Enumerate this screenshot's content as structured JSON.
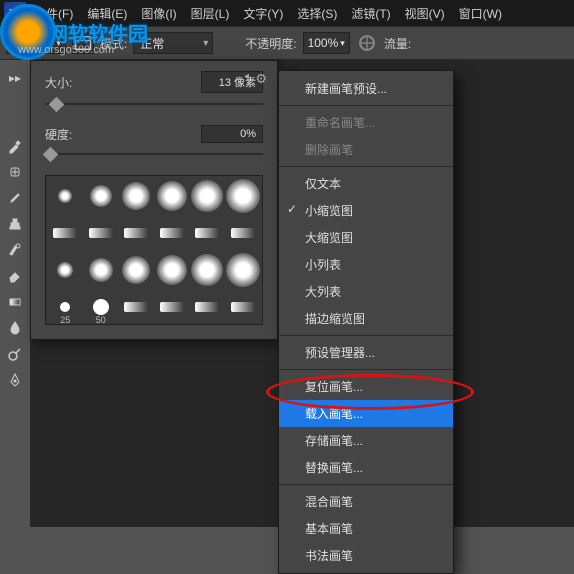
{
  "menubar": {
    "items": [
      {
        "label": "文件(F)"
      },
      {
        "label": "编辑(E)"
      },
      {
        "label": "图像(I)"
      },
      {
        "label": "图层(L)"
      },
      {
        "label": "文字(Y)"
      },
      {
        "label": "选择(S)"
      },
      {
        "label": "滤镜(T)"
      },
      {
        "label": "视图(V)"
      },
      {
        "label": "窗口(W)"
      }
    ]
  },
  "watermark": {
    "title": "网软软件园",
    "url": "www.orsgo500.com"
  },
  "optionbar": {
    "brush_size": "13",
    "mode_label": "模式:",
    "mode_value": "正常",
    "opacity_label": "不透明度:",
    "opacity_value": "100%",
    "flow_label": "流量:"
  },
  "brush_panel": {
    "size_label": "大小:",
    "size_value": "13 像素",
    "hardness_label": "硬度:",
    "hardness_value": "0%",
    "thumbs": [
      {
        "num": ""
      },
      {
        "num": ""
      },
      {
        "num": ""
      },
      {
        "num": ""
      },
      {
        "num": ""
      },
      {
        "num": ""
      },
      {
        "num": ""
      },
      {
        "num": ""
      },
      {
        "num": ""
      },
      {
        "num": ""
      },
      {
        "num": ""
      },
      {
        "num": ""
      },
      {
        "num": ""
      },
      {
        "num": ""
      },
      {
        "num": ""
      },
      {
        "num": ""
      },
      {
        "num": ""
      },
      {
        "num": ""
      },
      {
        "num": "25"
      },
      {
        "num": "50"
      },
      {
        "num": ""
      },
      {
        "num": ""
      },
      {
        "num": ""
      },
      {
        "num": ""
      }
    ]
  },
  "context_menu": {
    "groups": [
      [
        {
          "label": "新建画笔预设...",
          "state": ""
        }
      ],
      [
        {
          "label": "重命名画笔...",
          "state": "disabled"
        },
        {
          "label": "删除画笔",
          "state": "disabled"
        }
      ],
      [
        {
          "label": "仅文本",
          "state": ""
        },
        {
          "label": "小缩览图",
          "state": "checked"
        },
        {
          "label": "大缩览图",
          "state": ""
        },
        {
          "label": "小列表",
          "state": ""
        },
        {
          "label": "大列表",
          "state": ""
        },
        {
          "label": "描边缩览图",
          "state": ""
        }
      ],
      [
        {
          "label": "预设管理器...",
          "state": ""
        }
      ],
      [
        {
          "label": "复位画笔...",
          "state": ""
        },
        {
          "label": "载入画笔...",
          "state": "selected"
        },
        {
          "label": "存储画笔...",
          "state": ""
        },
        {
          "label": "替换画笔...",
          "state": ""
        }
      ],
      [
        {
          "label": "混合画笔",
          "state": ""
        },
        {
          "label": "基本画笔",
          "state": ""
        },
        {
          "label": "书法画笔",
          "state": ""
        }
      ]
    ]
  }
}
